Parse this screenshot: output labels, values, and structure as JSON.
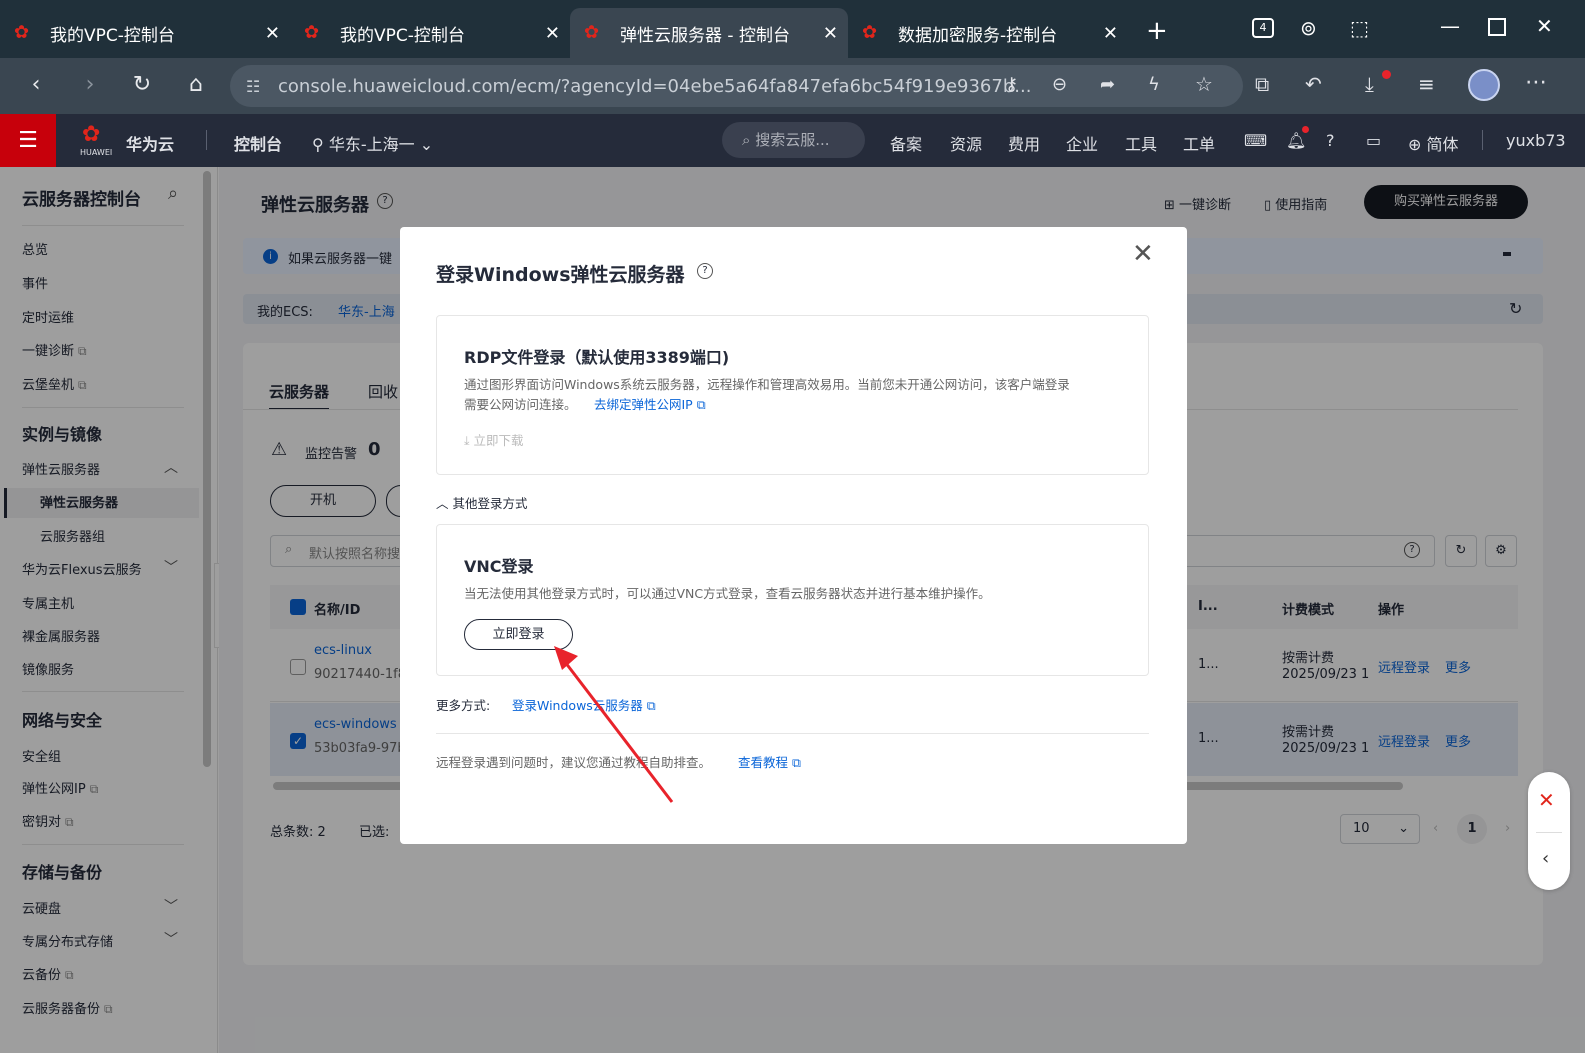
{
  "browser": {
    "tabs": [
      {
        "title": "我的VPC-控制台"
      },
      {
        "title": "我的VPC-控制台"
      },
      {
        "title": "弹性云服务器 - 控制台"
      },
      {
        "title": "数据加密服务-控制台"
      }
    ],
    "tab_count_badge": "4",
    "url": "console.huaweicloud.com/ecm/?agencyId=04ebe5a64fa847efa6bc54f919e9367b..."
  },
  "topnav": {
    "brand": "华为云",
    "brand_sub": "HUAWEI",
    "console": "控制台",
    "region": "华东-上海一",
    "search_placeholder": "搜索云服...",
    "links": [
      "备案",
      "资源",
      "费用",
      "企业",
      "工具",
      "工单"
    ],
    "language": "简体",
    "user": "yuxb73"
  },
  "sidebar": {
    "title": "云服务器控制台",
    "items_top": [
      {
        "label": "总览",
        "ext": false
      },
      {
        "label": "事件",
        "ext": false
      },
      {
        "label": "定时运维",
        "ext": false
      },
      {
        "label": "一键诊断",
        "ext": true
      },
      {
        "label": "云堡垒机",
        "ext": true
      }
    ],
    "section1": "实例与镜像",
    "ecs_group": "弹性云服务器",
    "ecs_item": "弹性云服务器",
    "ecs_group_item": "云服务器组",
    "flexus": "华为云Flexus云服务",
    "dedicated_host": "专属主机",
    "bms": "裸金属服务器",
    "ims": "镜像服务",
    "section2": "网络与安全",
    "security_group": "安全组",
    "eip": "弹性公网IP",
    "keypair": "密钥对",
    "section3": "存储与备份",
    "evs": "云硬盘",
    "dss": "专属分布式存储",
    "cbr": "云备份",
    "ecs_backup": "云服务器备份"
  },
  "main": {
    "page_title": "弹性云服务器",
    "diagnose": "一键诊断",
    "guide": "使用指南",
    "buy_button": "购买弹性云服务器",
    "notice": "如果云服务器一键",
    "my_ecs_label": "我的ECS:",
    "my_ecs_region": "华东-上海",
    "tab_servers": "云服务器",
    "tab_recycle": "回收",
    "alarm_label": "监控告警",
    "alarm_count": "0",
    "start_button": "开机",
    "search_placeholder": "默认按照名称搜",
    "col_name": "名称/ID",
    "col_ip": "I...",
    "col_billing": "计费模式",
    "col_ops": "操作",
    "rows": [
      {
        "name": "ecs-linux",
        "id": "90217440-1f8",
        "ip": "1...",
        "billing": "按需计费",
        "date": "2025/09/23 1",
        "remote": "远程登录",
        "more": "更多",
        "checked": false
      },
      {
        "name": "ecs-windows",
        "id": "53b03fa9-97b",
        "ip": "1...",
        "billing": "按需计费",
        "date": "2025/09/23 1",
        "remote": "远程登录",
        "more": "更多",
        "checked": true
      }
    ],
    "total_label": "总条数:",
    "total_value": "2",
    "selected_label": "已选:",
    "page_size": "10",
    "page_current": "1"
  },
  "modal": {
    "title": "登录Windows弹性云服务器",
    "rdp_title": "RDP文件登录（默认使用3389端口)",
    "rdp_desc_line1": "通过图形界面访问Windows系统云服务器，远程操作和管理高效易用。当前您未开通公网访问，该客户端登录",
    "rdp_desc_line2": "需要公网访问连接。",
    "rdp_bind_link": "去绑定弹性公网IP",
    "rdp_download": "立即下载",
    "other_methods": "其他登录方式",
    "vnc_title": "VNC登录",
    "vnc_desc": "当无法使用其他登录方式时，可以通过VNC方式登录，查看云服务器状态并进行基本维护操作。",
    "vnc_button": "立即登录",
    "more_label": "更多方式:",
    "more_link": "登录Windows云服务器",
    "help_text": "远程登录遇到问题时，建议您通过教程自助排查。",
    "help_link": "查看教程"
  },
  "colors": {
    "huawei_red": "#c7000b",
    "link_blue": "#0a65d8",
    "arrow_red": "#e8232b",
    "nav_dark": "#252b3a"
  }
}
